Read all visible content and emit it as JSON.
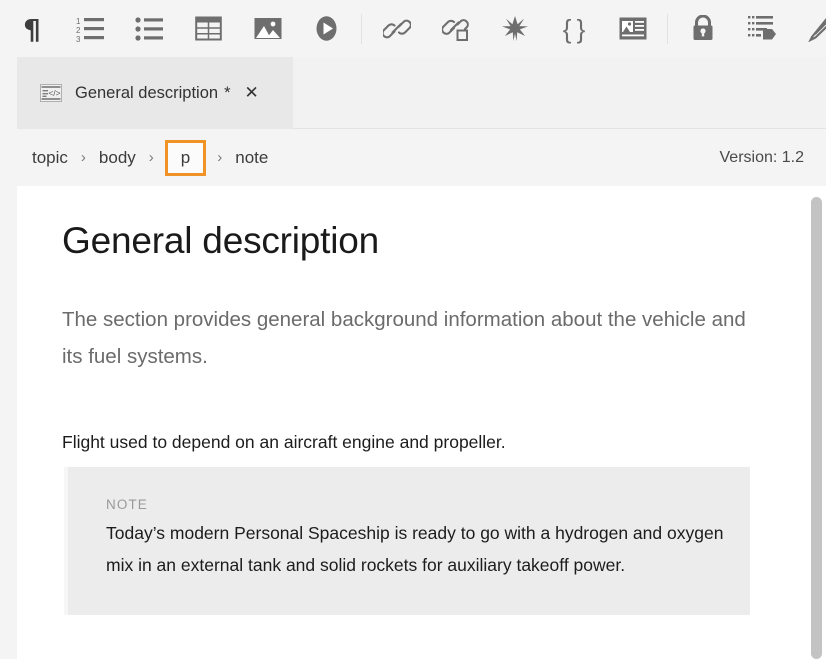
{
  "toolbar": {
    "buttons": [
      {
        "name": "paragraph-icon",
        "title": "Paragraph"
      },
      {
        "name": "ordered-list-icon",
        "title": "Ordered list"
      },
      {
        "name": "unordered-list-icon",
        "title": "Unordered list"
      },
      {
        "name": "table-icon",
        "title": "Table"
      },
      {
        "name": "image-icon",
        "title": "Image"
      },
      {
        "name": "media-play-icon",
        "title": "Media"
      },
      {
        "name": "link-icon",
        "title": "Link"
      },
      {
        "name": "link-object-icon",
        "title": "Cross reference"
      },
      {
        "name": "asterisk-icon",
        "title": "Special character"
      },
      {
        "name": "curly-braces-icon",
        "title": "Code"
      },
      {
        "name": "figure-icon",
        "title": "Figure"
      },
      {
        "name": "lock-icon",
        "title": "Lock"
      },
      {
        "name": "metadata-tag-icon",
        "title": "Metadata"
      },
      {
        "name": "edit-pencil-icon",
        "title": "Edit"
      }
    ]
  },
  "tab": {
    "icon": "xml-document-icon",
    "label": "General description",
    "dirty_marker": "*",
    "close_label": "✕"
  },
  "breadcrumb": {
    "items": [
      {
        "label": "topic",
        "active": false
      },
      {
        "label": "body",
        "active": false
      },
      {
        "label": "p",
        "active": true
      },
      {
        "label": "note",
        "active": false
      }
    ],
    "separator": "›",
    "active_color": "#ef9327"
  },
  "version": {
    "text": "Version: 1.2"
  },
  "document": {
    "title": "General description",
    "shortdesc": "The section provides general background information about the vehicle and its fuel systems.",
    "paragraph": "Flight used to depend on an aircraft engine and propeller.",
    "note": {
      "label": "NOTE",
      "body": " Today’s modern Personal Spaceship is ready to go with a hydrogen and oxygen mix in an external tank and solid rockets for auxiliary takeoff power."
    }
  },
  "colors": {
    "toolbar_bg": "#f4f4f4",
    "tab_bg": "#e8e8e8",
    "tabbar_bg": "#f2f2f2",
    "editor_bg": "#ffffff",
    "note_bg": "#ececec",
    "accent_orange": "#ef9327",
    "scrollbar_thumb": "#c3c3c3",
    "icon_gray": "#6e6e6e"
  }
}
